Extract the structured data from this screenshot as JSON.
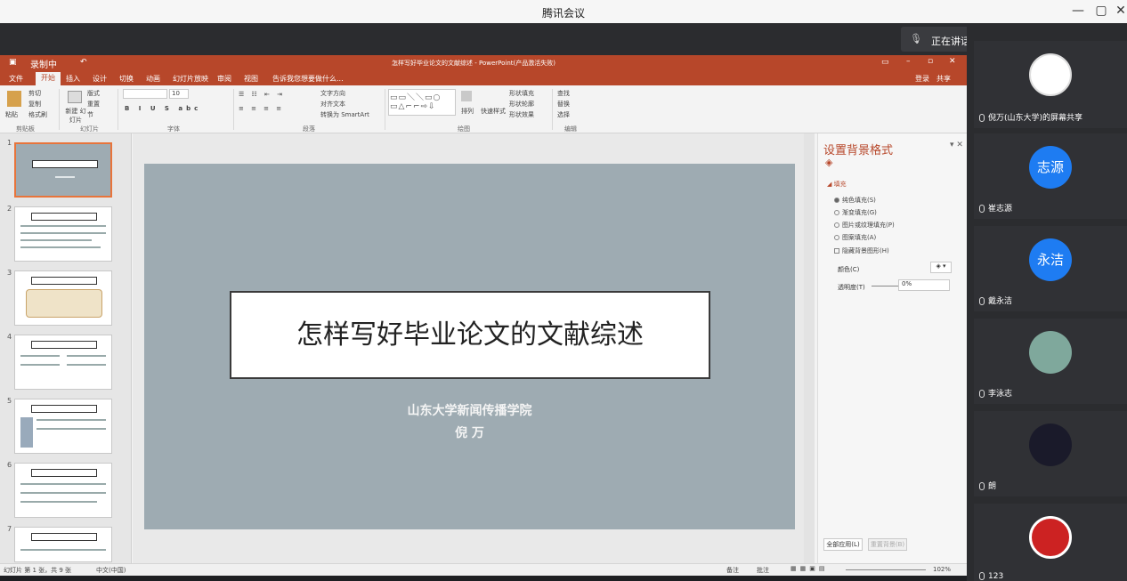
{
  "window": {
    "title": "腾讯会议",
    "min": "—",
    "restore": "▢",
    "close": "✕"
  },
  "speaking": {
    "label": "正在讲话:"
  },
  "ppt": {
    "title": "怎样写好毕业论文的文献综述 - PowerPoint(产品激活失败)",
    "qat": "录制中",
    "login": "登录",
    "share": "共享",
    "menus": [
      "文件",
      "开始",
      "插入",
      "设计",
      "切换",
      "动画",
      "幻灯片放映",
      "审阅",
      "视图"
    ],
    "search": "告诉我您想要做什么...",
    "ribbon": {
      "paste": "粘贴",
      "cut": "剪切",
      "copy": "复制",
      "fmt": "格式刷",
      "clipboard": "剪贴板",
      "newslide": "新建\n幻灯片",
      "layout": "版式",
      "reset": "重置",
      "section": "节",
      "slides": "幻灯片",
      "fontsize": "10",
      "font": "字体",
      "para": "段落",
      "textdir": "文字方向",
      "align": "对齐文本",
      "smart": "转换为 SmartArt",
      "arrange": "排列",
      "quick": "快速样式",
      "fill": "形状填充",
      "outline": "形状轮廓",
      "effect": "形状效果",
      "drawing": "绘图",
      "find": "查找",
      "replace": "替换",
      "select": "选择",
      "edit": "编辑"
    },
    "thumbs": [
      "1",
      "2",
      "3",
      "4",
      "5",
      "6",
      "7"
    ],
    "slide": {
      "title": "怎样写好毕业论文的文献综述",
      "sub1": "山东大学新闻传播学院",
      "sub2": "倪 万"
    },
    "pane": {
      "title": "设置背景格式",
      "fill": "填充",
      "options": [
        "纯色填充(S)",
        "渐变填充(G)",
        "图片或纹理填充(P)",
        "图案填充(A)"
      ],
      "hide": "隐藏背景图形(H)",
      "color": "颜色(C)",
      "transp": "透明度(T)",
      "transpVal": "0%",
      "applyAll": "全部应用(L)",
      "resetBg": "重置背景(B)"
    },
    "status": {
      "left": "幻灯片 第 1 张，共 9 张",
      "lang": "中文(中国)",
      "notes": "备注",
      "comments": "批注",
      "zoom": "102%"
    }
  },
  "participants": [
    {
      "name": "倪万(山东大学)的屏幕共享",
      "avatar": "",
      "color": "#ffffff"
    },
    {
      "name": "崔志源",
      "avatar": "志源",
      "color": "#1e7cf2"
    },
    {
      "name": "戴永洁",
      "avatar": "永洁",
      "color": "#1e7cf2"
    },
    {
      "name": "李泳志",
      "avatar": "",
      "color": "#7fa89c"
    },
    {
      "name": "朗",
      "avatar": "",
      "color": "#1a1a2a"
    },
    {
      "name": "123",
      "avatar": "",
      "color": "#cc2222"
    }
  ]
}
